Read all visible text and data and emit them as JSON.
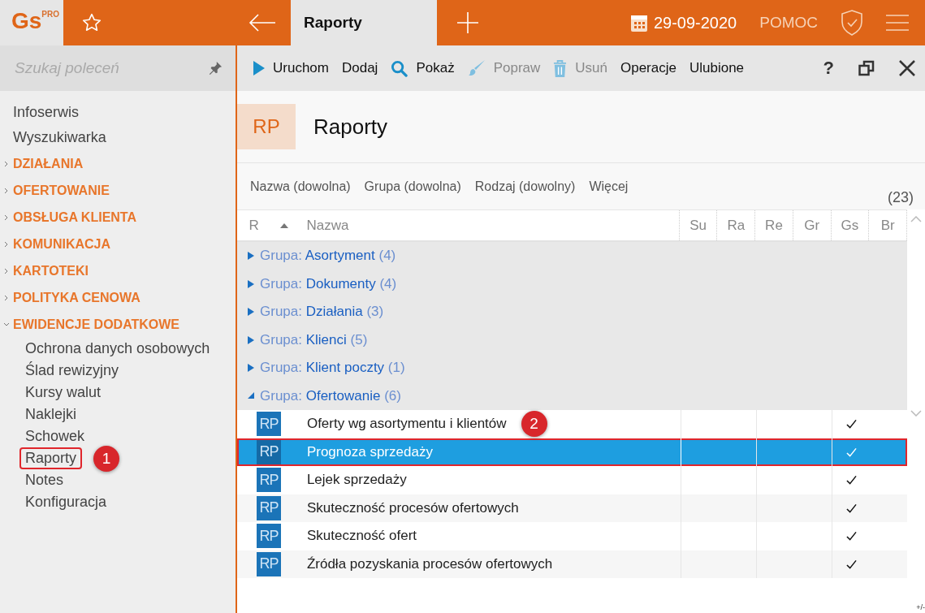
{
  "topbar": {
    "logo": {
      "text": "Gs",
      "badge": "PRO"
    },
    "tab_title": "Raporty",
    "date": "29-09-2020",
    "help": "POMOC"
  },
  "sidebar": {
    "search": {
      "placeholder": "Szukaj poleceń"
    },
    "items": [
      {
        "kind": "link",
        "label": "Infoserwis"
      },
      {
        "kind": "link",
        "label": "Wyszukiwarka"
      },
      {
        "kind": "section",
        "label": "DZIAŁANIA",
        "expanded": false
      },
      {
        "kind": "section",
        "label": "OFERTOWANIE",
        "expanded": false
      },
      {
        "kind": "section",
        "label": "OBSŁUGA KLIENTA",
        "expanded": false
      },
      {
        "kind": "section",
        "label": "KOMUNIKACJA",
        "expanded": false
      },
      {
        "kind": "section",
        "label": "KARTOTEKI",
        "expanded": false
      },
      {
        "kind": "section",
        "label": "POLITYKA CENOWA",
        "expanded": false
      },
      {
        "kind": "section",
        "label": "EWIDENCJE DODATKOWE",
        "expanded": true,
        "children": [
          {
            "label": "Ochrona danych osobowych",
            "marked": false
          },
          {
            "label": "Ślad rewizyjny",
            "marked": false
          },
          {
            "label": "Kursy walut",
            "marked": false
          },
          {
            "label": "Naklejki",
            "marked": false
          },
          {
            "label": "Schowek",
            "marked": false
          },
          {
            "label": "Raporty",
            "marked": true,
            "callout": "1"
          },
          {
            "label": "Notes",
            "marked": false
          },
          {
            "label": "Konfiguracja",
            "marked": false
          }
        ]
      }
    ]
  },
  "toolbar": {
    "buttons": [
      {
        "label": "Uruchom",
        "disabled": false
      },
      {
        "label": "Dodaj",
        "disabled": false
      },
      {
        "label": "Pokaż",
        "disabled": false
      },
      {
        "label": "Popraw",
        "disabled": true
      },
      {
        "label": "Usuń",
        "disabled": true
      },
      {
        "label": "Operacje",
        "disabled": false
      },
      {
        "label": "Ulubione",
        "disabled": false
      }
    ],
    "help": "?"
  },
  "header": {
    "badge": "RP",
    "title": "Raporty"
  },
  "filters": [
    "Nazwa (dowolna)",
    "Grupa (dowolna)",
    "Rodzaj (dowolny)",
    "Więcej"
  ],
  "count": "(23)",
  "table": {
    "columns": [
      {
        "label": "R",
        "sorted": true
      },
      {
        "label": "Nazwa",
        "sorted": false
      },
      {
        "label": "Su",
        "sorted": false
      },
      {
        "label": "Ra",
        "sorted": false
      },
      {
        "label": "Re",
        "sorted": false
      },
      {
        "label": "Gr",
        "sorted": false
      },
      {
        "label": "Gs",
        "sorted": false
      },
      {
        "label": "Br",
        "sorted": false
      }
    ],
    "groups": [
      {
        "prefix": "Grupa:",
        "name": "Asortyment",
        "count": "(4)",
        "expanded": false
      },
      {
        "prefix": "Grupa:",
        "name": "Dokumenty",
        "count": "(4)",
        "expanded": false
      },
      {
        "prefix": "Grupa:",
        "name": "Działania",
        "count": "(3)",
        "expanded": false
      },
      {
        "prefix": "Grupa:",
        "name": "Klienci",
        "count": "(5)",
        "expanded": false
      },
      {
        "prefix": "Grupa:",
        "name": "Klient poczty",
        "count": "(1)",
        "expanded": false
      },
      {
        "prefix": "Grupa:",
        "name": "Ofertowanie",
        "count": "(6)",
        "expanded": true,
        "children": [
          {
            "badge": "RP",
            "name": "Oferty wg asortymentu i klientów",
            "selected": false,
            "marked": false,
            "callout": "2",
            "checked": true
          },
          {
            "badge": "RP",
            "name": "Prognoza sprzedaży",
            "selected": true,
            "marked": true,
            "checked": true
          },
          {
            "badge": "RP",
            "name": "Lejek sprzedaży",
            "selected": false,
            "marked": false,
            "checked": true
          },
          {
            "badge": "RP",
            "name": "Skuteczność procesów ofertowych",
            "selected": false,
            "marked": false,
            "checked": true
          },
          {
            "badge": "RP",
            "name": "Skuteczność ofert",
            "selected": false,
            "marked": false,
            "checked": true
          },
          {
            "badge": "RP",
            "name": "Źródła pozyskania procesów ofertowych",
            "selected": false,
            "marked": false,
            "checked": true
          }
        ]
      }
    ]
  },
  "footer": {
    "toggle": "+/-"
  }
}
